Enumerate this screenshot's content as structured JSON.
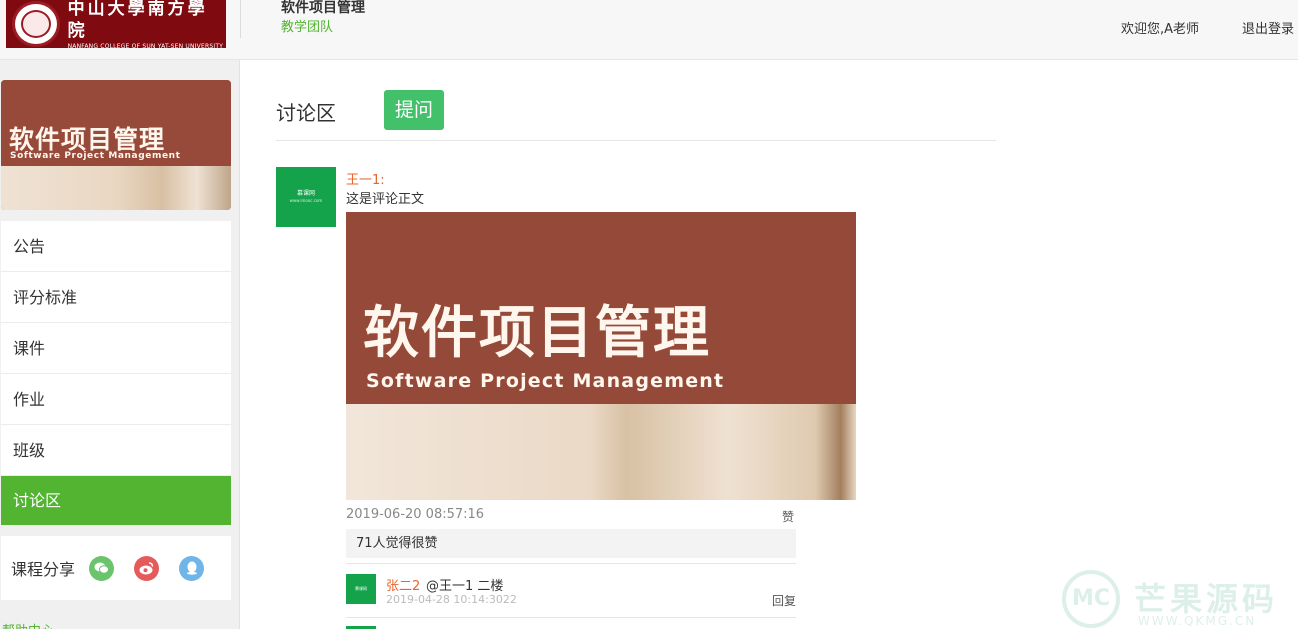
{
  "header": {
    "logo": {
      "cn": "中山大學南方學院",
      "en": "NANFANG COLLEGE OF SUN YAT-SEN UNIVERSITY"
    },
    "course_title": "软件项目管理",
    "course_team": "教学团队",
    "welcome": "欢迎您,A老师",
    "logout": "退出登录"
  },
  "sidebar": {
    "cover": {
      "title": "软件项目管理",
      "subtitle": "Software Project Management"
    },
    "items": [
      {
        "label": "公告"
      },
      {
        "label": "评分标准"
      },
      {
        "label": "课件"
      },
      {
        "label": "作业"
      },
      {
        "label": "班级"
      },
      {
        "label": "讨论区",
        "active": true
      }
    ],
    "share_label": "课程分享",
    "share_icons": [
      "wechat-icon",
      "weibo-icon",
      "qq-icon"
    ],
    "help": "帮助中心"
  },
  "main": {
    "title": "讨论区",
    "ask_button": "提问",
    "post": {
      "author": "王一1:",
      "text": "这是评论正文",
      "image": {
        "title": "软件项目管理",
        "subtitle": "Software Project Management"
      },
      "date": "2019-06-20 08:57:16",
      "like": "赞",
      "likes_text": "71人觉得很赞"
    },
    "replies": [
      {
        "author": "张二2",
        "text": "@王一1 二楼",
        "date": "2019-04-28 10:14:3022",
        "reply_label": "回复"
      }
    ]
  },
  "colors": {
    "accent_green": "#52b431",
    "button_green": "#42c06a",
    "avatar_green": "#14a34a",
    "author_orange": "#e9642c",
    "brand_red": "#7f0a10"
  }
}
